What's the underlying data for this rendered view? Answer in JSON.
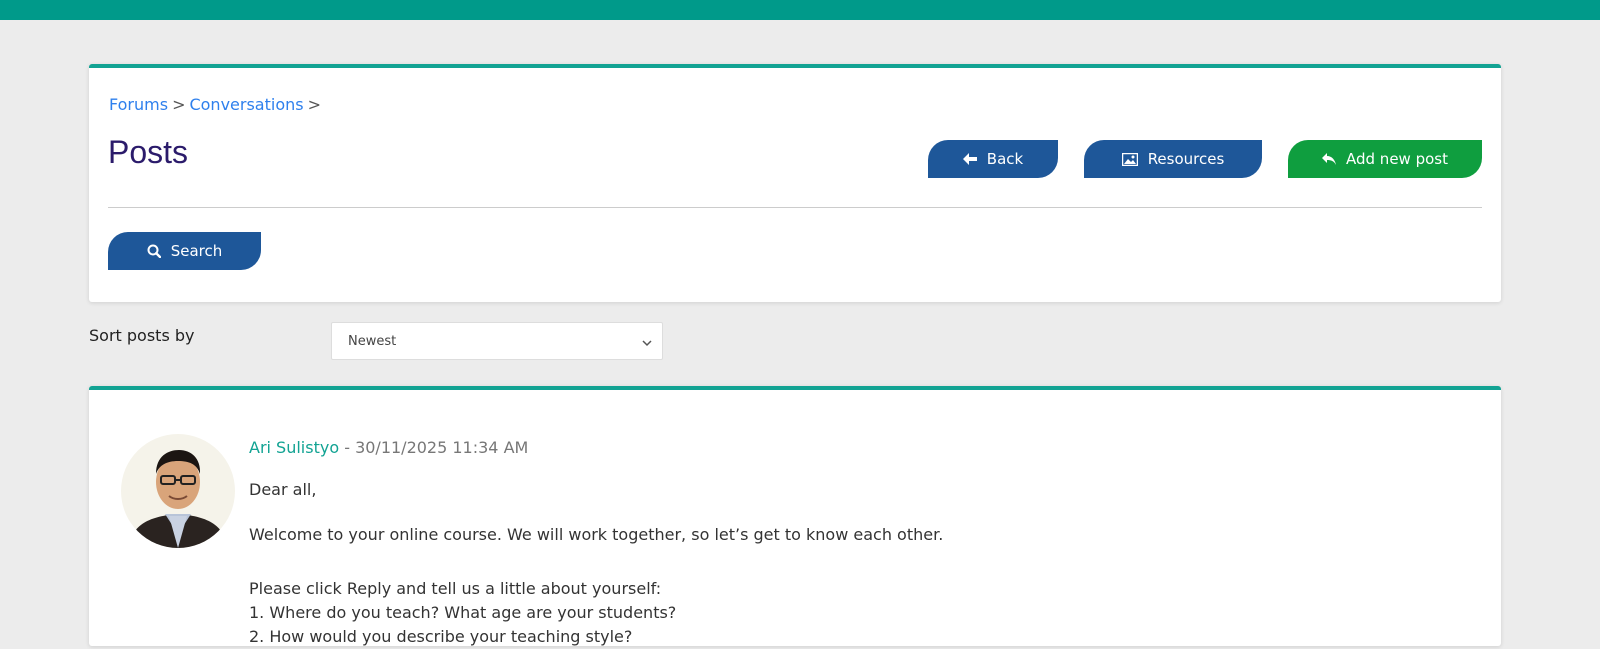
{
  "colors": {
    "topbar": "#009a8a",
    "accent": "#12a393",
    "link": "#2f80ed",
    "title": "#2b1b6b",
    "button_blue": "#1e5799",
    "button_green": "#0f9e3f"
  },
  "breadcrumb": {
    "items": [
      "Forums",
      "Conversations"
    ],
    "separator": ">"
  },
  "header": {
    "title": "Posts",
    "back_label": "Back",
    "resources_label": "Resources",
    "add_post_label": "Add new post",
    "search_label": "Search",
    "icons": {
      "back": "arrow-left-icon",
      "resources": "image-icon",
      "add_post": "reply-icon",
      "search": "search-icon"
    }
  },
  "sort": {
    "label": "Sort posts by",
    "selected": "Newest"
  },
  "post": {
    "author": "Ari Sulistyo",
    "separator": " - ",
    "date": "30/11/2025 11:34 AM",
    "body": [
      "Dear all,",
      "Welcome to your online course. We will work together, so let’s get to know each other.",
      "Please click Reply and tell us a little about yourself:",
      "1. Where do you teach? What age are your students?",
      "2. How would you describe your teaching style?"
    ]
  }
}
